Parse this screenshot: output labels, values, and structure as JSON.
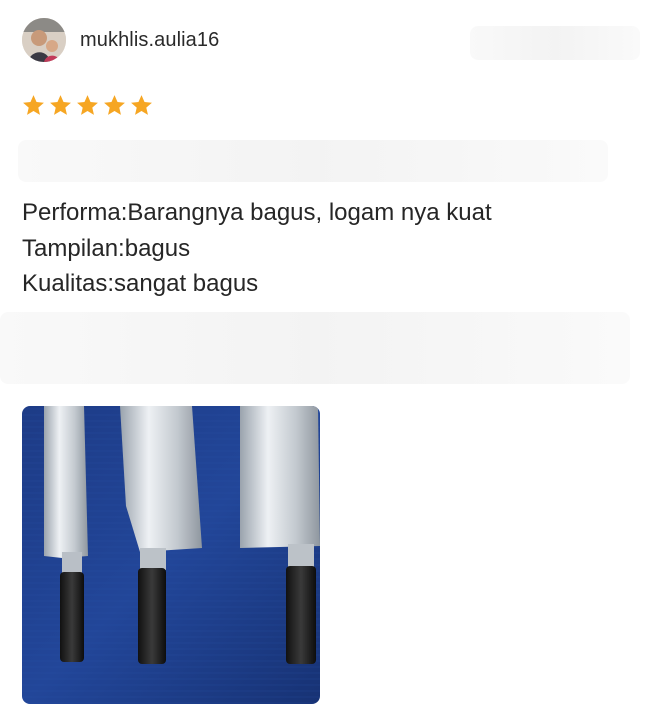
{
  "review": {
    "username": "mukhlis.aulia16",
    "rating": 5,
    "rating_max": 5,
    "star_color": "#f6a623",
    "lines": [
      "Performa:Barangnya bagus, logam nya kuat",
      "Tampilan:bagus",
      "Kualitas:sangat bagus"
    ]
  },
  "icons": {
    "avatar": "user-avatar-photo",
    "star": "star-icon"
  },
  "photo": {
    "subject": "three kitchen knives on blue cloth",
    "background_color": "#1f3f8a"
  }
}
